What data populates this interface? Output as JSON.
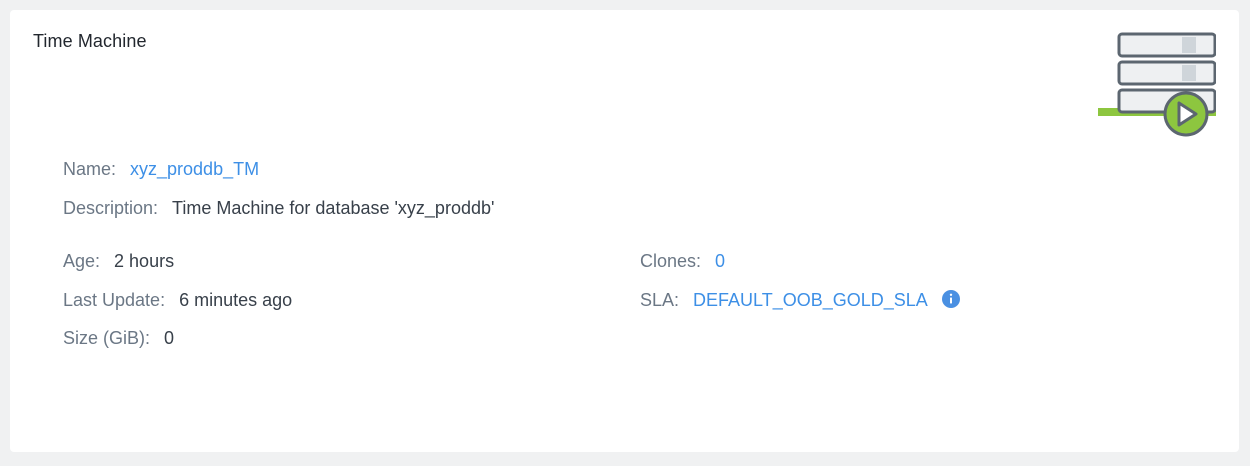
{
  "card": {
    "title": "Time Machine",
    "icon": "time-machine-database-play-icon"
  },
  "details": {
    "name_label": "Name:",
    "name_value": "xyz_proddb_TM",
    "description_label": "Description:",
    "description_value": "Time Machine for database 'xyz_proddb'",
    "age_label": "Age:",
    "age_value": "2 hours",
    "last_update_label": "Last Update:",
    "last_update_value": "6 minutes ago",
    "size_label": "Size (GiB):",
    "size_value": "0",
    "clones_label": "Clones:",
    "clones_value": "0",
    "sla_label": "SLA:",
    "sla_value": "DEFAULT_OOB_GOLD_SLA",
    "sla_info_icon": "info-icon"
  },
  "colors": {
    "link": "#3d8fe6",
    "label": "#6b7785",
    "value": "#38404a",
    "accent_green": "#8dc63f",
    "info_blue": "#4a90e2"
  }
}
